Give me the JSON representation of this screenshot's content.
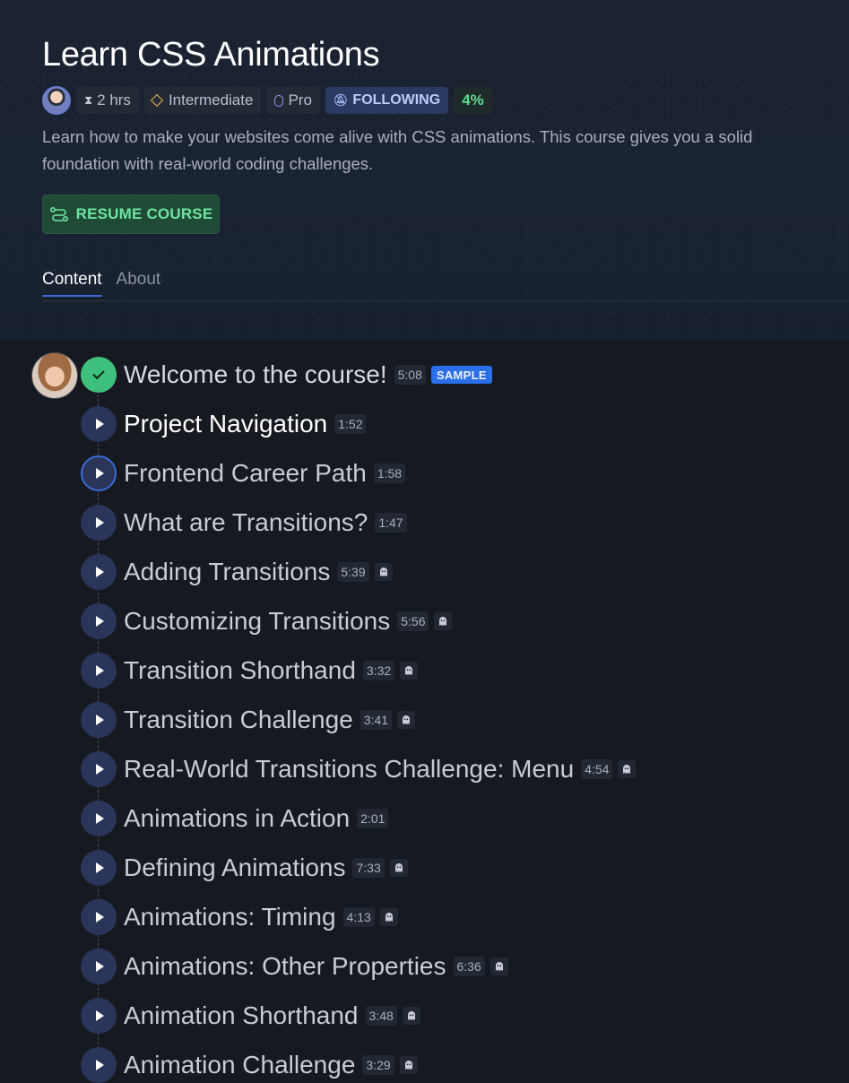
{
  "course": {
    "title": "Learn CSS Animations",
    "duration": "2 hrs",
    "level": "Intermediate",
    "tier": "Pro",
    "follow_status": "FOLLOWING",
    "progress": "4%",
    "description": "Learn how to make your websites come alive with CSS animations. This course gives you a solid foundation with real-world coding challenges.",
    "resume_label": "RESUME COURSE"
  },
  "tabs": [
    {
      "label": "Content",
      "active": true
    },
    {
      "label": "About",
      "active": false
    }
  ],
  "lessons": [
    {
      "title": "Welcome to the course!",
      "duration": "5:08",
      "badge": "SAMPLE",
      "state": "done"
    },
    {
      "title": "Project Navigation",
      "duration": "1:52",
      "state": "hover"
    },
    {
      "title": "Frontend Career Path",
      "duration": "1:58",
      "state": "current"
    },
    {
      "title": "What are Transitions?",
      "duration": "1:47"
    },
    {
      "title": "Adding Transitions",
      "duration": "5:39",
      "icon": "ghost-icon"
    },
    {
      "title": "Customizing Transitions",
      "duration": "5:56",
      "icon": "ghost-icon"
    },
    {
      "title": "Transition Shorthand",
      "duration": "3:32",
      "icon": "ghost-icon"
    },
    {
      "title": "Transition Challenge",
      "duration": "3:41",
      "icon": "ghost-icon"
    },
    {
      "title": "Real-World Transitions Challenge: Menu",
      "duration": "4:54",
      "icon": "ghost-icon"
    },
    {
      "title": "Animations in Action",
      "duration": "2:01"
    },
    {
      "title": "Defining Animations",
      "duration": "7:33",
      "icon": "ghost-icon"
    },
    {
      "title": "Animations: Timing",
      "duration": "4:13",
      "icon": "ghost-icon"
    },
    {
      "title": "Animations: Other Properties",
      "duration": "6:36",
      "icon": "ghost-icon"
    },
    {
      "title": "Animation Shorthand",
      "duration": "3:48",
      "icon": "ghost-icon"
    },
    {
      "title": "Animation Challenge",
      "duration": "3:29",
      "icon": "ghost-icon"
    }
  ],
  "colors": {
    "accent": "#3b6ad6",
    "success": "#3ec07d",
    "resume_text": "#6fe5a3",
    "background": "#16191f"
  }
}
